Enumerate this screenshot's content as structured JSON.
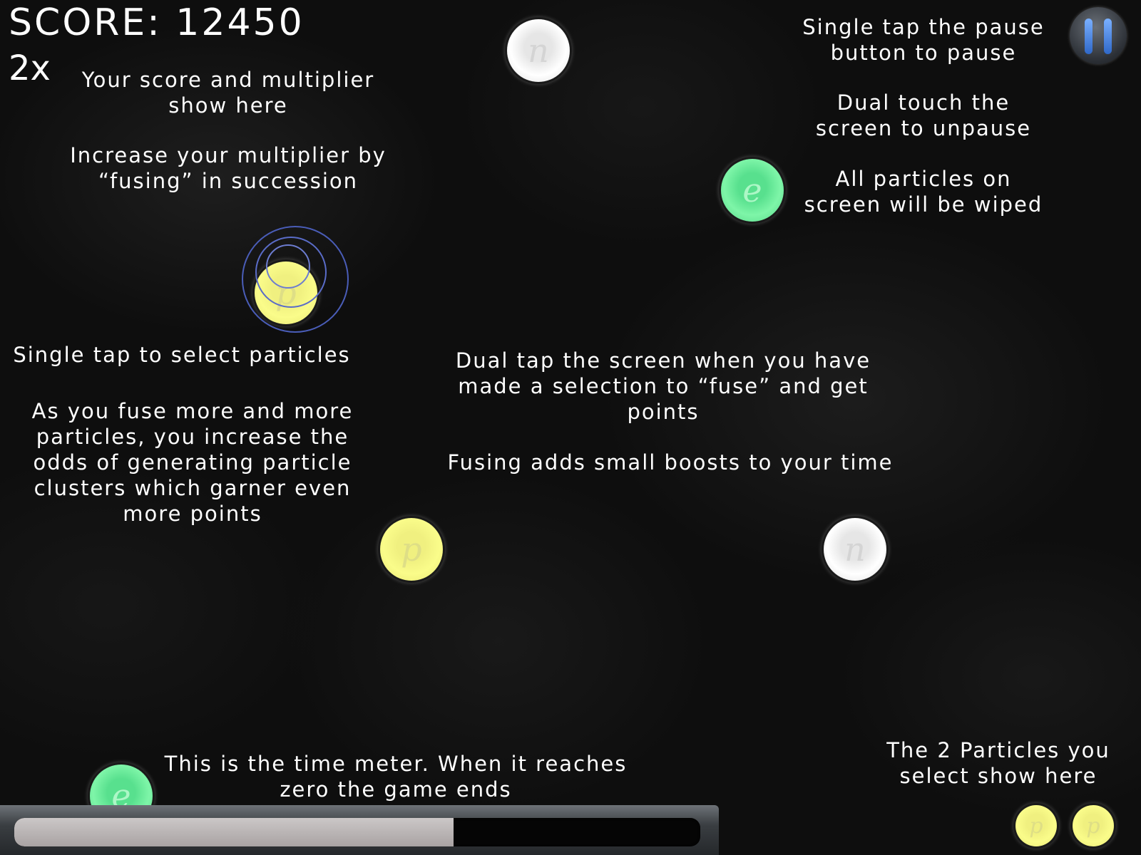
{
  "hud": {
    "score_text": "SCORE: 12450",
    "multiplier_text": "2x"
  },
  "tips": {
    "score_multiplier": "Your score and multiplier\nshow here",
    "increase_multiplier": "Increase your multiplier by\n“fusing” in succession",
    "pause_tap": "Single tap the pause\nbutton to pause",
    "unpause": "Dual touch the\nscreen to unpause",
    "wipe": "All particles on\nscreen will be wiped",
    "select": "Single tap to select particles",
    "clusters": "As you fuse more and more\nparticles, you increase the\nodds of generating particle\nclusters which garner even\nmore points",
    "dual_tap": "Dual tap the screen when you have\nmade a selection to “fuse” and get\npoints",
    "boost": "Fusing adds small boosts to your time",
    "time_meter": "This is the time meter. When it reaches\nzero the game ends",
    "selected_show": "The 2 Particles you\nselect show here"
  },
  "particles": {
    "top_white": {
      "symbol": "n",
      "color": "white"
    },
    "green_right": {
      "symbol": "e",
      "color": "green"
    },
    "selected_yellow": {
      "symbol": "p",
      "color": "yellow"
    },
    "mid_yellow": {
      "symbol": "p",
      "color": "yellow"
    },
    "mid_white": {
      "symbol": "n",
      "color": "white"
    },
    "bottom_green": {
      "symbol": "e",
      "color": "green"
    },
    "slot1": {
      "symbol": "p",
      "color": "yellow"
    },
    "slot2": {
      "symbol": "p",
      "color": "yellow"
    }
  },
  "time_meter": {
    "remaining_fraction": 0.64
  },
  "colors": {
    "white_particle": "#f2f2f2",
    "green_particle": "#6cf09c",
    "yellow_particle": "#f6f884",
    "pause_bars": "#4a86e8",
    "selection_rings": "#4a5db8"
  }
}
